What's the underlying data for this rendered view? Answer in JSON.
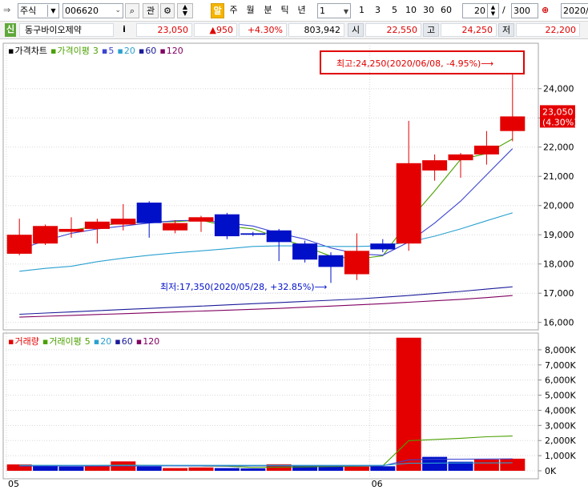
{
  "toolbar": {
    "market": "주식",
    "code": "006620",
    "btn_gwan": "관",
    "periods": [
      "알",
      "주",
      "월",
      "분",
      "틱",
      "년"
    ],
    "interval_value": "1",
    "quick_intervals": [
      "1",
      "3",
      "5",
      "10",
      "30",
      "60"
    ],
    "count": "20",
    "slash": "/",
    "total": "300",
    "date_value": "2020/"
  },
  "info": {
    "tag": "신",
    "name": "동구바이오제약",
    "i_btn": "i",
    "price": "23,050",
    "change": "▲950",
    "change_pct": "+4.30%",
    "volume": "803,942",
    "open_label": "시",
    "open": "22,550",
    "high_label": "고",
    "high": "24,250",
    "low_label": "저",
    "low": "22,200"
  },
  "colors": {
    "up": "#e40000",
    "down": "#0010c8",
    "ma3": "#4aa000",
    "ma5": "#3a44d0",
    "ma20": "#2aa0d0",
    "ma60": "#1a1a9a",
    "ma120": "#800060"
  },
  "chart_data": [
    {
      "type": "candlestick",
      "legend": [
        {
          "marker": "▪",
          "text": "가격차트",
          "color": "#000000"
        },
        {
          "marker": "▪",
          "text": "가격이평",
          "color": "#4aa000"
        },
        {
          "marker": "",
          "text": "3",
          "color": "#4aa000"
        },
        {
          "marker": "▪",
          "text": "5",
          "color": "#3a44d0"
        },
        {
          "marker": "▪",
          "text": "20",
          "color": "#2aa0d0"
        },
        {
          "marker": "▪",
          "text": "60",
          "color": "#1a1a9a"
        },
        {
          "marker": "▪",
          "text": "120",
          "color": "#800060"
        }
      ],
      "ylim": [
        15800,
        25500
      ],
      "yticks": [
        16000,
        17000,
        18000,
        19000,
        20000,
        21000,
        22000,
        23000,
        24000
      ],
      "ytick_labels": [
        "16,000",
        "17,000",
        "18,000",
        "19,000",
        "20,000",
        "21,000",
        "22,000",
        "23,000",
        "24,000"
      ],
      "x_labels": [
        {
          "index": 0,
          "text": "05"
        },
        {
          "index": 14,
          "text": "06"
        }
      ],
      "candles": [
        {
          "o": 18350,
          "h": 19550,
          "l": 18300,
          "c": 19000
        },
        {
          "o": 18700,
          "h": 19350,
          "l": 18650,
          "c": 19300
        },
        {
          "o": 19100,
          "h": 19600,
          "l": 18900,
          "c": 19200
        },
        {
          "o": 19200,
          "h": 19550,
          "l": 18700,
          "c": 19450
        },
        {
          "o": 19350,
          "h": 20050,
          "l": 19150,
          "c": 19550
        },
        {
          "o": 20100,
          "h": 20150,
          "l": 18900,
          "c": 19400
        },
        {
          "o": 19150,
          "h": 19500,
          "l": 19050,
          "c": 19400
        },
        {
          "o": 19450,
          "h": 19650,
          "l": 19100,
          "c": 19600
        },
        {
          "o": 19700,
          "h": 19750,
          "l": 18850,
          "c": 18950
        },
        {
          "o": 19050,
          "h": 19100,
          "l": 18950,
          "c": 19000
        },
        {
          "o": 19150,
          "h": 19200,
          "l": 18100,
          "c": 18750
        },
        {
          "o": 18700,
          "h": 18800,
          "l": 18050,
          "c": 18150
        },
        {
          "o": 18300,
          "h": 18400,
          "l": 17350,
          "c": 17900
        },
        {
          "o": 17650,
          "h": 19050,
          "l": 17450,
          "c": 18450
        },
        {
          "o": 18700,
          "h": 18850,
          "l": 18400,
          "c": 18500
        },
        {
          "o": 18700,
          "h": 22900,
          "l": 18450,
          "c": 21450
        },
        {
          "o": 21200,
          "h": 21750,
          "l": 20850,
          "c": 21550
        },
        {
          "o": 21550,
          "h": 21800,
          "l": 20950,
          "c": 21750
        },
        {
          "o": 21750,
          "h": 22550,
          "l": 21400,
          "c": 22050
        },
        {
          "o": 22550,
          "h": 24250,
          "l": 22200,
          "c": 23050
        }
      ],
      "ma": [
        {
          "period": 3,
          "color": "#4aa000",
          "values": [
            null,
            null,
            19150,
            19300,
            19400,
            19450,
            19450,
            19500,
            19300,
            19200,
            18900,
            18600,
            18270,
            18170,
            18280,
            19470,
            20500,
            21580,
            21780,
            22280
          ]
        },
        {
          "period": 5,
          "color": "#3a44d0",
          "values": [
            18500,
            18800,
            19050,
            19200,
            19300,
            19400,
            19480,
            19500,
            19400,
            19300,
            19050,
            18850,
            18550,
            18350,
            18300,
            18750,
            19400,
            20150,
            21050,
            21950
          ]
        },
        {
          "period": 20,
          "color": "#2aa0d0",
          "values": [
            17750,
            17850,
            17920,
            18080,
            18200,
            18300,
            18380,
            18450,
            18520,
            18600,
            18620,
            18620,
            18600,
            18600,
            18620,
            18750,
            18950,
            19200,
            19480,
            19750
          ]
        },
        {
          "period": 60,
          "color": "#1a1a9a",
          "values": [
            16280,
            16320,
            16360,
            16400,
            16440,
            16480,
            16520,
            16560,
            16600,
            16640,
            16680,
            16720,
            16760,
            16800,
            16860,
            16920,
            16990,
            17060,
            17140,
            17220
          ]
        },
        {
          "period": 120,
          "color": "#800060",
          "values": [
            16180,
            16210,
            16240,
            16270,
            16300,
            16330,
            16360,
            16390,
            16420,
            16450,
            16480,
            16520,
            16560,
            16600,
            16640,
            16690,
            16740,
            16790,
            16850,
            16920
          ]
        }
      ],
      "current_label": {
        "line1": "23,050",
        "line2": "(4.30%)",
        "value": 23050
      },
      "annotations": {
        "high": {
          "text": "최고:24,250(2020/06/08, -4.95%)",
          "arrow": "⟶",
          "value": 24250,
          "index": 19
        },
        "low": {
          "text": "최저:17,350(2020/05/28, +32.85%)",
          "arrow": "⟶",
          "value": 17350,
          "index": 12
        }
      }
    },
    {
      "type": "bar",
      "legend": [
        {
          "marker": "▪",
          "text": "거래량",
          "color": "#e40000"
        },
        {
          "marker": "▪",
          "text": "거래이평",
          "color": "#4aa000"
        },
        {
          "marker": "",
          "text": "5",
          "color": "#4aa000"
        },
        {
          "marker": "▪",
          "text": "20",
          "color": "#2aa0d0"
        },
        {
          "marker": "▪",
          "text": "60",
          "color": "#1a1a9a"
        },
        {
          "marker": "▪",
          "text": "120",
          "color": "#800060"
        }
      ],
      "ylim": [
        0,
        9000
      ],
      "yticks": [
        0,
        1000,
        2000,
        3000,
        4000,
        5000,
        6000,
        7000,
        8000
      ],
      "ytick_labels": [
        "0K",
        "1,000K",
        "2,000K",
        "3,000K",
        "4,000K",
        "5,000K",
        "6,000K",
        "7,000K",
        "8,000K"
      ],
      "values": [
        420,
        300,
        280,
        300,
        620,
        290,
        180,
        220,
        180,
        160,
        430,
        330,
        310,
        280,
        300,
        8800,
        920,
        600,
        750,
        800
      ],
      "up_flags": [
        true,
        false,
        false,
        true,
        true,
        false,
        true,
        true,
        false,
        false,
        true,
        false,
        false,
        true,
        false,
        true,
        false,
        false,
        true,
        true
      ],
      "ma": [
        {
          "period": 5,
          "color": "#4aa000",
          "values": [
            350,
            350,
            340,
            350,
            380,
            360,
            340,
            320,
            300,
            220,
            240,
            260,
            280,
            300,
            330,
            1990,
            2070,
            2150,
            2250,
            2300
          ]
        },
        {
          "period": 20,
          "color": "#3a44d0",
          "values": [
            320,
            320,
            320,
            320,
            330,
            330,
            330,
            330,
            330,
            330,
            330,
            330,
            330,
            330,
            330,
            720,
            760,
            770,
            780,
            790
          ]
        },
        {
          "period": 60,
          "color": "#2aa0d0",
          "values": [
            360,
            360,
            360,
            360,
            360,
            360,
            360,
            360,
            360,
            360,
            360,
            360,
            360,
            360,
            360,
            500,
            510,
            520,
            520,
            530
          ]
        }
      ]
    }
  ]
}
